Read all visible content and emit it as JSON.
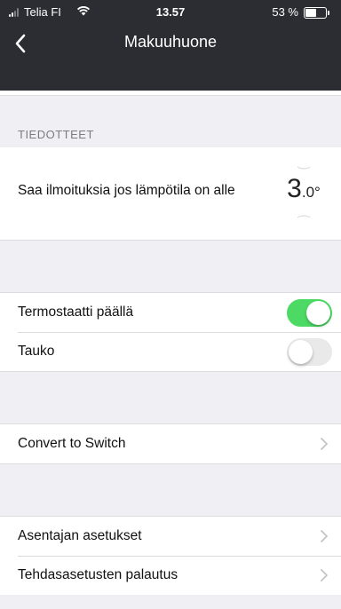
{
  "status_bar": {
    "carrier": "Telia FI",
    "time": "13.57",
    "battery_percent": "53 %",
    "battery_level": 0.53
  },
  "nav": {
    "title": "Makuuhuone"
  },
  "notifications_section": {
    "header": "TIEDOTTEET",
    "alert_label": "Saa ilmoituksia jos lämpötila on alle",
    "temp_integer": "3",
    "temp_decimal": ".0°"
  },
  "toggles": [
    {
      "label": "Termostaatti päällä",
      "on": true
    },
    {
      "label": "Tauko",
      "on": false
    }
  ],
  "convert": {
    "label": "Convert to Switch"
  },
  "settings": [
    {
      "label": "Asentajan asetukset"
    },
    {
      "label": "Tehdasasetusten palautus"
    }
  ],
  "colors": {
    "header_bg": "#2b2d33",
    "switch_on": "#4cd964",
    "switch_off": "#e9e9ea"
  }
}
